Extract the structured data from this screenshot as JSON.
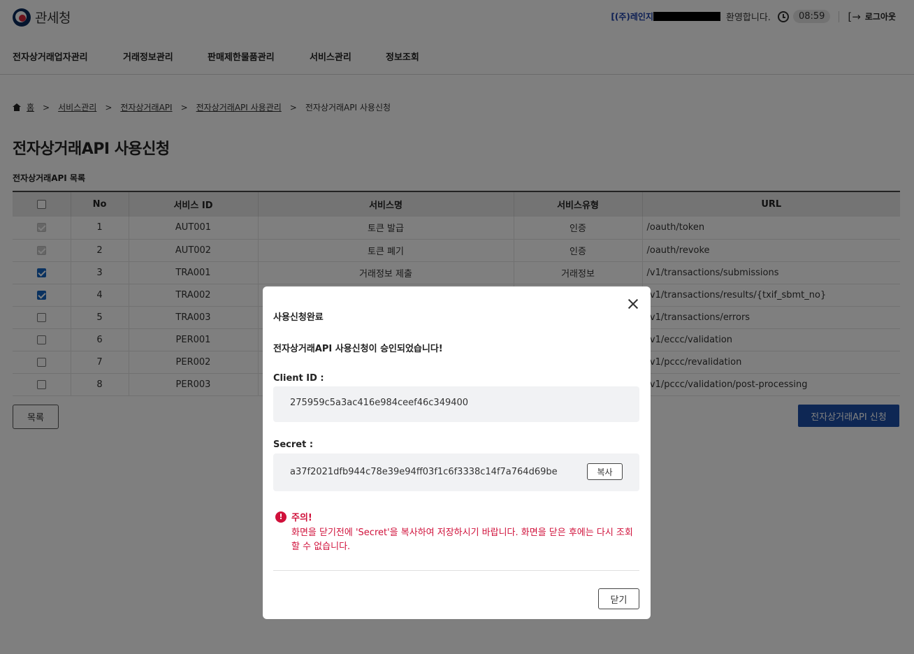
{
  "header": {
    "logo_text": "관세청",
    "company": "[(주)레인지",
    "welcome": "환영합니다.",
    "timer": "08:59",
    "logout": "로그아웃"
  },
  "nav": {
    "items": [
      "전자상거래업자관리",
      "거래정보관리",
      "판매제한물품관리",
      "서비스관리",
      "정보조회"
    ]
  },
  "breadcrumb": {
    "home": "홈",
    "items": [
      "서비스관리",
      "전자상거래API",
      "전자상거래API 사용관리"
    ],
    "current": "전자상거래API 사용신청",
    "separator": ">"
  },
  "page": {
    "title": "전자상거래API 사용신청",
    "list_title": "전자상거래API 목록",
    "list_button": "목록",
    "apply_button": "전자상거래API 신청"
  },
  "table": {
    "headers": [
      "",
      "No",
      "서비스 ID",
      "서비스명",
      "서비스유형",
      "URL"
    ],
    "rows": [
      {
        "state": "disabled",
        "no": "1",
        "id": "AUT001",
        "name": "토큰 발급",
        "type": "인증",
        "url": "/oauth/token"
      },
      {
        "state": "disabled",
        "no": "2",
        "id": "AUT002",
        "name": "토큰 폐기",
        "type": "인증",
        "url": "/oauth/revoke"
      },
      {
        "state": "checked",
        "no": "3",
        "id": "TRA001",
        "name": "거래정보 제출",
        "type": "거래정보",
        "url": "/v1/transactions/submissions"
      },
      {
        "state": "checked",
        "no": "4",
        "id": "TRA002",
        "name": "",
        "type": "",
        "url": "/v1/transactions/results/{txif_sbmt_no}"
      },
      {
        "state": "unchecked",
        "no": "5",
        "id": "TRA003",
        "name": "",
        "type": "",
        "url": "/v1/transactions/errors"
      },
      {
        "state": "unchecked",
        "no": "6",
        "id": "PER001",
        "name": "",
        "type": "",
        "url": "/v1/eccc/validation"
      },
      {
        "state": "unchecked",
        "no": "7",
        "id": "PER002",
        "name": "",
        "type": "",
        "url": "/v1/pccc/revalidation"
      },
      {
        "state": "unchecked",
        "no": "8",
        "id": "PER003",
        "name": "",
        "type": "",
        "url": "/v1/pccc/validation/post-processing"
      }
    ]
  },
  "modal": {
    "title": "사용신청완료",
    "message": "전자상거래API 사용신청이 승인되었습니다!",
    "client_id_label": "Client ID :",
    "client_id": "275959c5a3ac416e984ceef46c349400",
    "secret_label": "Secret :",
    "secret": "a37f2021dfb944c78e39e94ff03f1c6f3338c14f7a764d69be",
    "copy_button": "복사",
    "warning_title": "주의!",
    "warning_text": "화면을 닫기전에 'Secret'을 복사하여 저장하시기 바랍니다. 화면을 닫은 후에는 다시 조회할 수 없습니다.",
    "close_button": "닫기"
  },
  "colors": {
    "primary": "#1d4fa8",
    "warning": "#d0103a",
    "checkbox": "#1565c0"
  }
}
